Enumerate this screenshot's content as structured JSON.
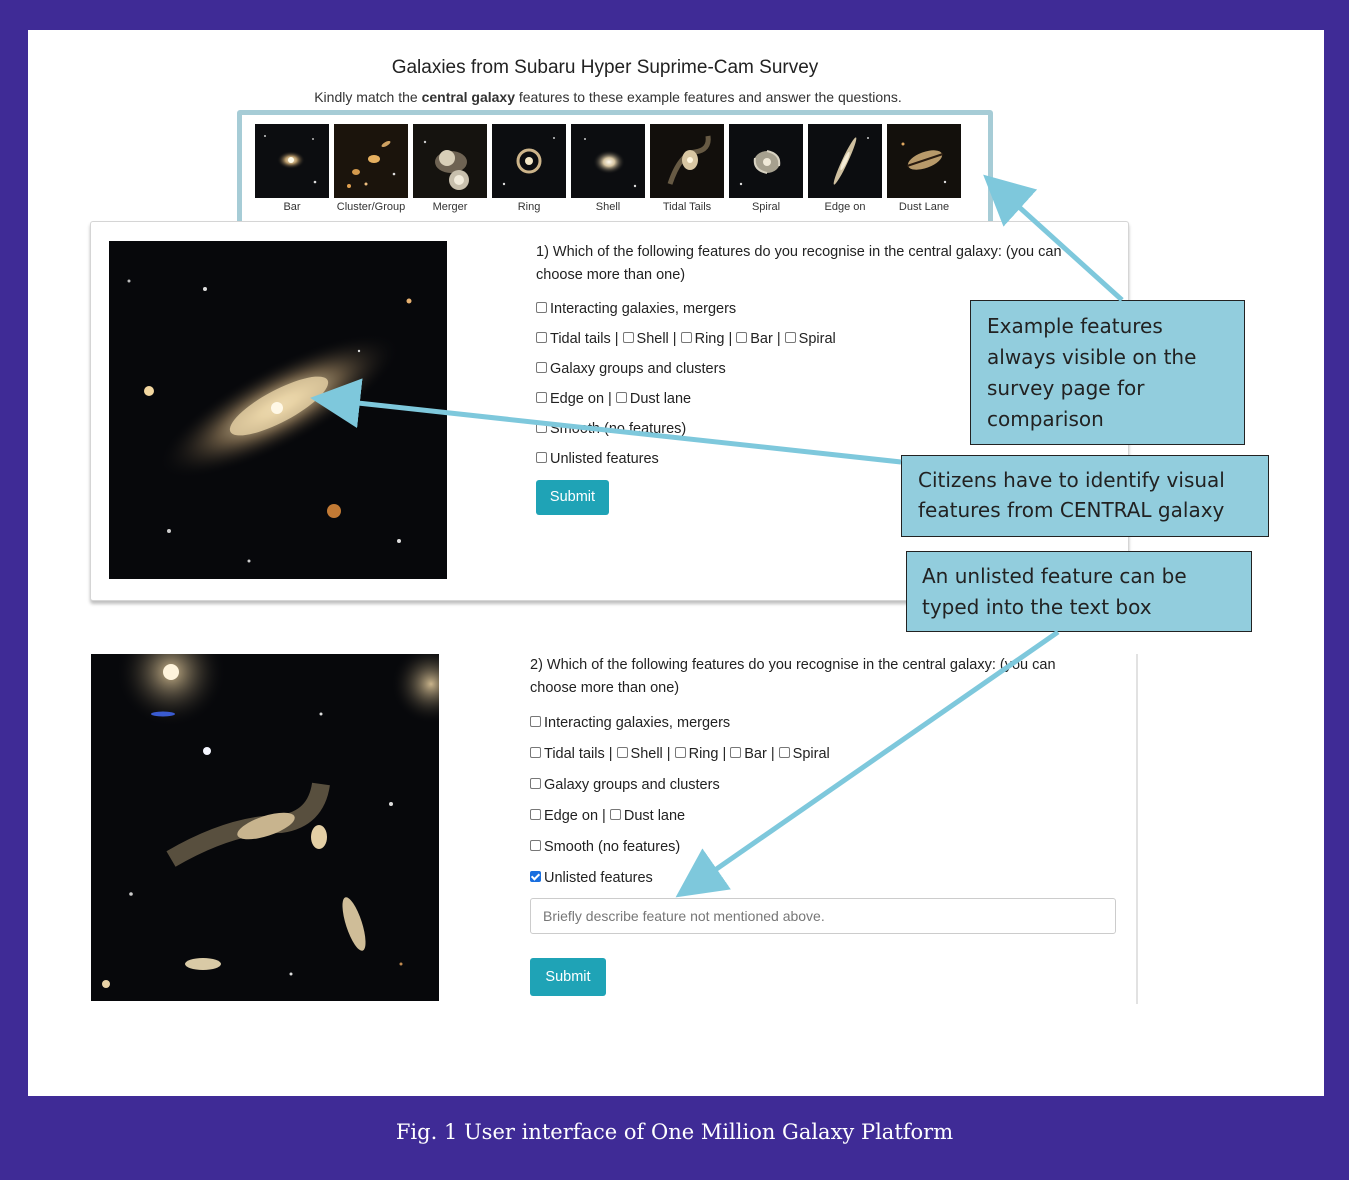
{
  "survey": {
    "title": "Galaxies from Subaru Hyper Suprime-Cam Survey",
    "instruction_prefix": "Kindly match the ",
    "instruction_bold": "central galaxy",
    "instruction_suffix": " features to these example features and answer the questions."
  },
  "examples": [
    {
      "label": "Bar",
      "icon": "bar-galaxy-thumbnail"
    },
    {
      "label": "Cluster/Group",
      "icon": "cluster-galaxy-thumbnail"
    },
    {
      "label": "Merger",
      "icon": "merger-galaxy-thumbnail"
    },
    {
      "label": "Ring",
      "icon": "ring-galaxy-thumbnail"
    },
    {
      "label": "Shell",
      "icon": "shell-galaxy-thumbnail"
    },
    {
      "label": "Tidal Tails",
      "icon": "tidal-tails-galaxy-thumbnail"
    },
    {
      "label": "Spiral",
      "icon": "spiral-galaxy-thumbnail"
    },
    {
      "label": "Edge on",
      "icon": "edge-on-galaxy-thumbnail"
    },
    {
      "label": "Dust Lane",
      "icon": "dust-lane-galaxy-thumbnail"
    }
  ],
  "question1": {
    "line1": "1) Which of the following features do you recognise in the central galaxy: (you can",
    "line2": "choose more than one)",
    "opt_interacting": "Interacting galaxies, mergers",
    "opt_tidal": "Tidal tails |",
    "opt_shell": "Shell |",
    "opt_ring": "Ring |",
    "opt_bar": "Bar |",
    "opt_spiral": "Spiral",
    "opt_groups": "Galaxy groups and clusters",
    "opt_edge": "Edge on |",
    "opt_dust": "Dust lane",
    "opt_smooth": "Smooth (no features)",
    "opt_unlisted": "Unlisted features",
    "submit": "Submit"
  },
  "question2": {
    "line1": "2) Which of the following features do you recognise in the central galaxy: (you can",
    "line2": "choose more than one)",
    "opt_interacting": "Interacting galaxies, mergers",
    "opt_tidal": "Tidal tails |",
    "opt_shell": "Shell |",
    "opt_ring": "Ring |",
    "opt_bar": "Bar |",
    "opt_spiral": "Spiral",
    "opt_groups": "Galaxy groups and clusters",
    "opt_edge": "Edge on |",
    "opt_dust": "Dust lane",
    "opt_smooth": "Smooth (no features)",
    "opt_unlisted": "Unlisted features",
    "unlisted_checked": true,
    "placeholder": "Briefly describe feature not mentioned above.",
    "submit": "Submit"
  },
  "callouts": {
    "examples_visible": [
      "Example features",
      "always visible on the",
      "survey page for",
      "comparison"
    ],
    "identify_central": [
      "Citizens have to identify visual",
      "features from CENTRAL galaxy"
    ],
    "unlisted_textbox": [
      "An unlisted feature can be",
      "typed into the text box"
    ]
  },
  "caption": "Fig. 1 User interface of One Million Galaxy Platform",
  "colors": {
    "frame": "#3f2b96",
    "callout_fill": "#92cddd",
    "arrow": "#7ec8dc",
    "submit_button": "#1fa3b6",
    "checkbox_checked": "#1a6fdf"
  }
}
